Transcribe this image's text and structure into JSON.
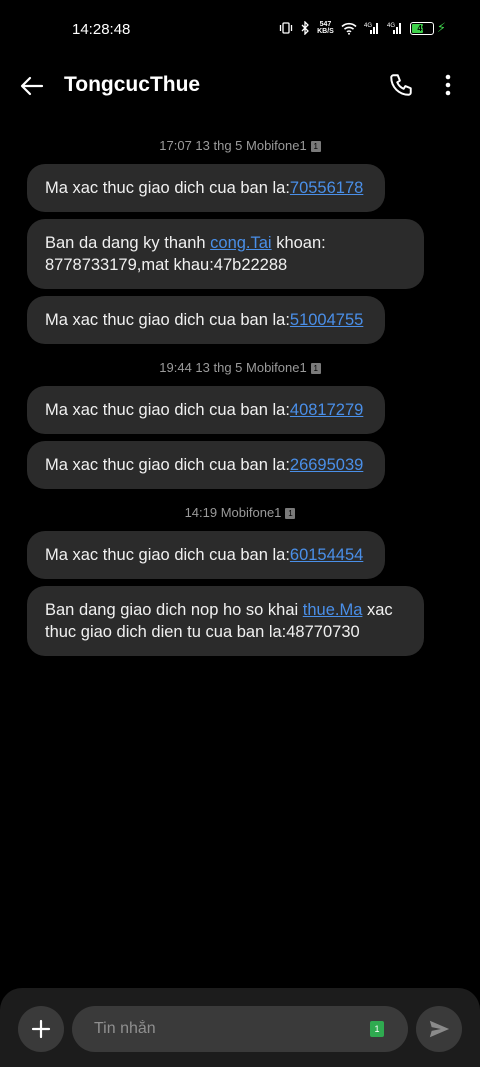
{
  "status_bar": {
    "time": "14:28:48",
    "net_speed_value": "547",
    "net_speed_unit": "KB/S",
    "battery_level": "49",
    "icons": [
      "vibrate-icon",
      "bluetooth-icon",
      "wifi-icon",
      "signal-4g-icon",
      "signal-4g-icon",
      "battery-icon",
      "charging-icon"
    ]
  },
  "header": {
    "title": "TongcucThue",
    "icons": [
      "back-arrow-icon",
      "phone-icon",
      "more-vert-icon"
    ]
  },
  "groups": [
    {
      "stamp": "17:07 13 thg 5 Mobifone1",
      "sim": "1",
      "messages": [
        {
          "text": "Ma xac thuc giao dich cua ban la:",
          "link": "70556178",
          "after": ""
        },
        {
          "text": "Ban da dang ky thanh ",
          "link": "cong.Tai",
          "after": " khoan: 8778733179,mat khau:47b22288"
        },
        {
          "text": "Ma xac thuc giao dich cua ban la:",
          "link": "51004755",
          "after": ""
        }
      ]
    },
    {
      "stamp": "19:44 13 thg 5 Mobifone1",
      "sim": "1",
      "messages": [
        {
          "text": "Ma xac thuc giao dich cua ban la:",
          "link": "40817279",
          "after": ""
        },
        {
          "text": "Ma xac thuc giao dich cua ban la:",
          "link": "26695039",
          "after": ""
        }
      ]
    },
    {
      "stamp": "14:19 Mobifone1",
      "sim": "1",
      "messages": [
        {
          "text": "Ma xac thuc giao dich cua ban la:",
          "link": "60154454",
          "after": ""
        },
        {
          "text": "Ban dang giao dich nop ho so khai ",
          "link": "thue.Ma",
          "after": " xac thuc giao dich dien tu cua ban la:48770730"
        }
      ]
    }
  ],
  "composer": {
    "placeholder": "Tin nhắn",
    "sim_badge": "1",
    "icons": [
      "plus-icon",
      "send-icon"
    ]
  },
  "colors": {
    "background": "#000000",
    "bubble": "#2b2b2b",
    "link": "#4a8fe8",
    "composer": "#1c1c1c",
    "sim_badge": "#2faa50"
  }
}
